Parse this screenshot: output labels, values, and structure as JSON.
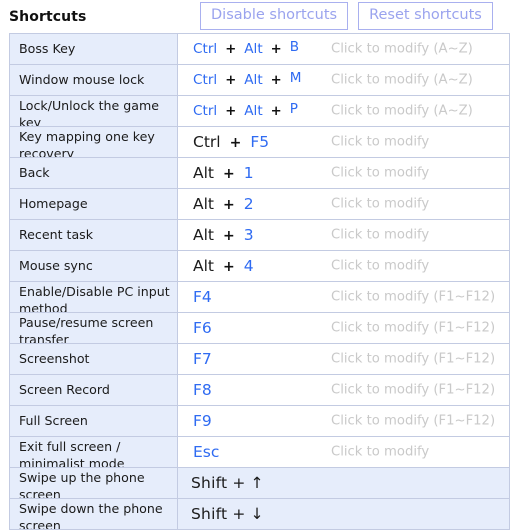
{
  "header": {
    "title": "Shortcuts",
    "disable_label": "Disable shortcuts",
    "reset_label": "Reset shortcuts"
  },
  "hints": {
    "az": "Click to modify (A~Z)",
    "plain": "Click to modify",
    "fn": "Click to modify (F1~F12)"
  },
  "rows": [
    {
      "label": "Boss Key",
      "keys": [
        {
          "text": "Ctrl",
          "style": "blue"
        },
        {
          "text": "+",
          "style": "plus"
        },
        {
          "text": "Alt",
          "style": "blue"
        },
        {
          "text": "+",
          "style": "plus"
        },
        {
          "text": "B",
          "style": "blue-raised"
        }
      ],
      "hint": "Click to modify (A~Z)",
      "size": "small",
      "two_line": false,
      "full_blue": false
    },
    {
      "label": "Window mouse lock",
      "keys": [
        {
          "text": "Ctrl",
          "style": "blue"
        },
        {
          "text": "+",
          "style": "plus"
        },
        {
          "text": "Alt",
          "style": "blue"
        },
        {
          "text": "+",
          "style": "plus"
        },
        {
          "text": "M",
          "style": "blue-raised"
        }
      ],
      "hint": "Click to modify (A~Z)",
      "size": "small",
      "two_line": false,
      "full_blue": false
    },
    {
      "label": "Lock/Unlock the game key",
      "keys": [
        {
          "text": "Ctrl",
          "style": "blue"
        },
        {
          "text": "+",
          "style": "plus"
        },
        {
          "text": "Alt",
          "style": "blue"
        },
        {
          "text": "+",
          "style": "plus"
        },
        {
          "text": "P",
          "style": "blue-raised"
        }
      ],
      "hint": "Click to modify (A~Z)",
      "size": "small",
      "two_line": true,
      "full_blue": false
    },
    {
      "label": "Key mapping one key recovery",
      "keys": [
        {
          "text": "Ctrl",
          "style": "dark"
        },
        {
          "text": "+",
          "style": "plus"
        },
        {
          "text": "F5",
          "style": "blue"
        }
      ],
      "hint": "Click to modify",
      "size": "big",
      "two_line": true,
      "full_blue": false
    },
    {
      "label": "Back",
      "keys": [
        {
          "text": "Alt",
          "style": "dark"
        },
        {
          "text": "+",
          "style": "plus"
        },
        {
          "text": "1",
          "style": "blue"
        }
      ],
      "hint": "Click to modify",
      "size": "big",
      "two_line": false,
      "full_blue": false
    },
    {
      "label": "Homepage",
      "keys": [
        {
          "text": "Alt",
          "style": "dark"
        },
        {
          "text": "+",
          "style": "plus"
        },
        {
          "text": "2",
          "style": "blue"
        }
      ],
      "hint": "Click to modify",
      "size": "big",
      "two_line": false,
      "full_blue": false
    },
    {
      "label": "Recent task",
      "keys": [
        {
          "text": "Alt",
          "style": "dark"
        },
        {
          "text": "+",
          "style": "plus"
        },
        {
          "text": "3",
          "style": "blue"
        }
      ],
      "hint": "Click to modify",
      "size": "big",
      "two_line": false,
      "full_blue": false
    },
    {
      "label": "Mouse sync",
      "keys": [
        {
          "text": "Alt",
          "style": "dark"
        },
        {
          "text": "+",
          "style": "plus"
        },
        {
          "text": "4",
          "style": "blue"
        }
      ],
      "hint": "Click to modify",
      "size": "big",
      "two_line": false,
      "full_blue": false
    },
    {
      "label": "Enable/Disable PC input method",
      "keys": [
        {
          "text": "F4",
          "style": "blue"
        }
      ],
      "hint": "Click to modify (F1~F12)",
      "size": "big",
      "two_line": true,
      "full_blue": false
    },
    {
      "label": "Pause/resume screen transfer",
      "keys": [
        {
          "text": "F6",
          "style": "blue"
        }
      ],
      "hint": "Click to modify (F1~F12)",
      "size": "big",
      "two_line": true,
      "full_blue": false
    },
    {
      "label": "Screenshot",
      "keys": [
        {
          "text": "F7",
          "style": "blue"
        }
      ],
      "hint": "Click to modify (F1~F12)",
      "size": "big",
      "two_line": false,
      "full_blue": false
    },
    {
      "label": "Screen Record",
      "keys": [
        {
          "text": "F8",
          "style": "blue"
        }
      ],
      "hint": "Click to modify (F1~F12)",
      "size": "big",
      "two_line": false,
      "full_blue": false
    },
    {
      "label": "Full Screen",
      "keys": [
        {
          "text": "F9",
          "style": "blue"
        }
      ],
      "hint": "Click to modify (F1~F12)",
      "size": "big",
      "two_line": false,
      "full_blue": false
    },
    {
      "label": "Exit full screen / minimalist mode",
      "keys": [
        {
          "text": "Esc",
          "style": "blue"
        }
      ],
      "hint": "Click to modify",
      "size": "big",
      "two_line": true,
      "full_blue": false
    },
    {
      "label": "Swipe up the phone screen",
      "plain_text": "Shift + ↑",
      "hint": "",
      "size": "plain",
      "two_line": true,
      "full_blue": true
    },
    {
      "label": "Swipe down the phone screen",
      "plain_text": "Shift + ↓",
      "hint": "",
      "size": "plain",
      "two_line": true,
      "full_blue": true
    }
  ],
  "colors": {
    "key_blue": "#2f6bf2",
    "key_dark": "#222222",
    "label_bg": "#e6edfb",
    "border": "#c3cbe2",
    "hint_gray": "#c9c9c9",
    "button_accent": "#9aa3ee"
  }
}
